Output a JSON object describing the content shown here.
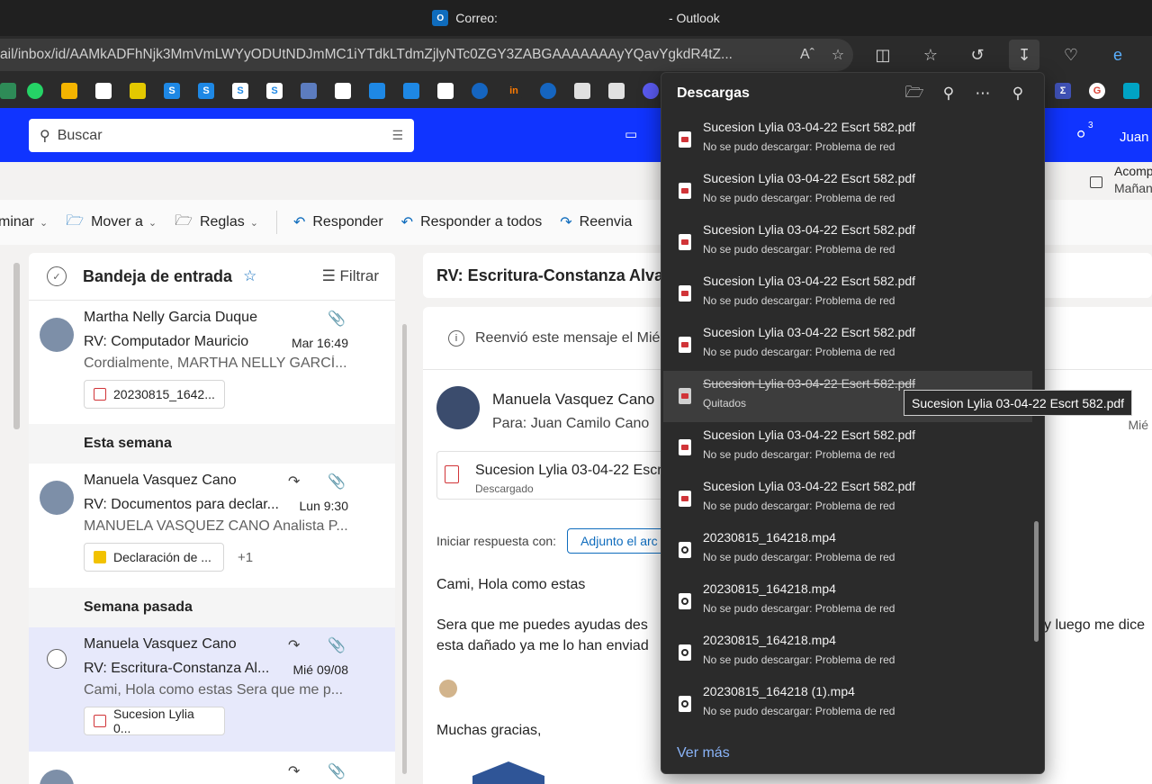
{
  "window": {
    "title_prefix": "Correo: ",
    "title_suffix": "- Outlook",
    "url": "ail/inbox/id/AAMkADFhNjk3MmVmLWYyODUtNDJmMC1iYTdkLTdmZjlyNTc0ZGY3ZABGAAAAAAAyYQavYgkdR4tZ..."
  },
  "search": {
    "placeholder": "Buscar"
  },
  "header_right": {
    "badge": "3",
    "user": "Juan"
  },
  "reminder": {
    "title": "Acomp",
    "subtitle": "Mañan"
  },
  "toolbar": {
    "delete": "minar",
    "move": "Mover a",
    "rules": "Reglas",
    "reply": "Responder",
    "reply_all": "Responder a todos",
    "forward": "Reenvia"
  },
  "list": {
    "title": "Bandeja de entrada",
    "filter": "Filtrar",
    "groups": {
      "this_week": "Esta semana",
      "last_week": "Semana pasada"
    },
    "messages": [
      {
        "sender": "Martha Nelly Garcia Duque",
        "subject": "RV: Computador Mauricio",
        "date": "Mar 16:49",
        "preview": "Cordialmente, MARTHA NELLY GARCÍ...",
        "attachment": "20230815_1642..."
      },
      {
        "sender": "Manuela Vasquez Cano",
        "subject": "RV: Documentos para declar...",
        "date": "Lun 9:30",
        "preview": "MANUELA VASQUEZ CANO Analista P...",
        "attachment": "Declaración de ...",
        "extra": "+1"
      },
      {
        "sender": "Manuela Vasquez Cano",
        "subject": "RV: Escritura-Constanza Al...",
        "date": "Mié 09/08",
        "preview": "Cami, Hola como estas Sera que me p...",
        "attachment": "Sucesion Lylia 0..."
      }
    ]
  },
  "reading": {
    "subject": "RV: Escritura-Constanza Alva",
    "info": "Reenvió este mensaje el Mié",
    "from": "Manuela Vasquez Cano",
    "to_label": "Para:",
    "to": "Juan Camilo Cano",
    "date": "Mié",
    "attachment_name": "Sucesion Lylia 03-04-22 Escr",
    "attachment_status": "Descargado",
    "reply_label": "Iniciar respuesta con:",
    "reply_button": "Adjunto el arc",
    "greeting": "Cami, Hola como estas",
    "body_line1": "Sera que me puedes ayudas des",
    "body_line1_tail": "y luego me dice",
    "body_line2": "esta dañado ya me lo han enviad",
    "thanks": "Muchas gracias,"
  },
  "downloads": {
    "title": "Descargas",
    "more": "Ver más",
    "tooltip": "Sucesion Lylia 03-04-22 Escrt 582.pdf",
    "items": [
      {
        "name": "Sucesion Lylia 03-04-22 Escrt 582.pdf",
        "status": "No se pudo descargar: Problema de red",
        "type": "pdf"
      },
      {
        "name": "Sucesion Lylia 03-04-22 Escrt 582.pdf",
        "status": "No se pudo descargar: Problema de red",
        "type": "pdf"
      },
      {
        "name": "Sucesion Lylia 03-04-22 Escrt 582.pdf",
        "status": "No se pudo descargar: Problema de red",
        "type": "pdf"
      },
      {
        "name": "Sucesion Lylia 03-04-22 Escrt 582.pdf",
        "status": "No se pudo descargar: Problema de red",
        "type": "pdf"
      },
      {
        "name": "Sucesion Lylia 03-04-22 Escrt 582.pdf",
        "status": "No se pudo descargar: Problema de red",
        "type": "pdf"
      },
      {
        "name": "Sucesion Lylia 03-04-22 Escrt 582.pdf",
        "status": "Quitados",
        "type": "pdf-removed"
      },
      {
        "name": "Sucesion Lylia 03-04-22 Escrt 582.pdf",
        "status": "No se pudo descargar: Problema de red",
        "type": "pdf"
      },
      {
        "name": "Sucesion Lylia 03-04-22 Escrt 582.pdf",
        "status": "No se pudo descargar: Problema de red",
        "type": "pdf"
      },
      {
        "name": "20230815_164218.mp4",
        "status": "No se pudo descargar: Problema de red",
        "type": "mp4"
      },
      {
        "name": "20230815_164218.mp4",
        "status": "No se pudo descargar: Problema de red",
        "type": "mp4"
      },
      {
        "name": "20230815_164218.mp4",
        "status": "No se pudo descargar: Problema de red",
        "type": "mp4"
      },
      {
        "name": "20230815_164218 (1).mp4",
        "status": "No se pudo descargar: Problema de red",
        "type": "mp4"
      }
    ]
  },
  "colors": {
    "outlook_blue": "#1034ff",
    "accent": "#0f6cbd",
    "flyout_bg": "#2b2b2b",
    "link": "#8ab4f8"
  }
}
